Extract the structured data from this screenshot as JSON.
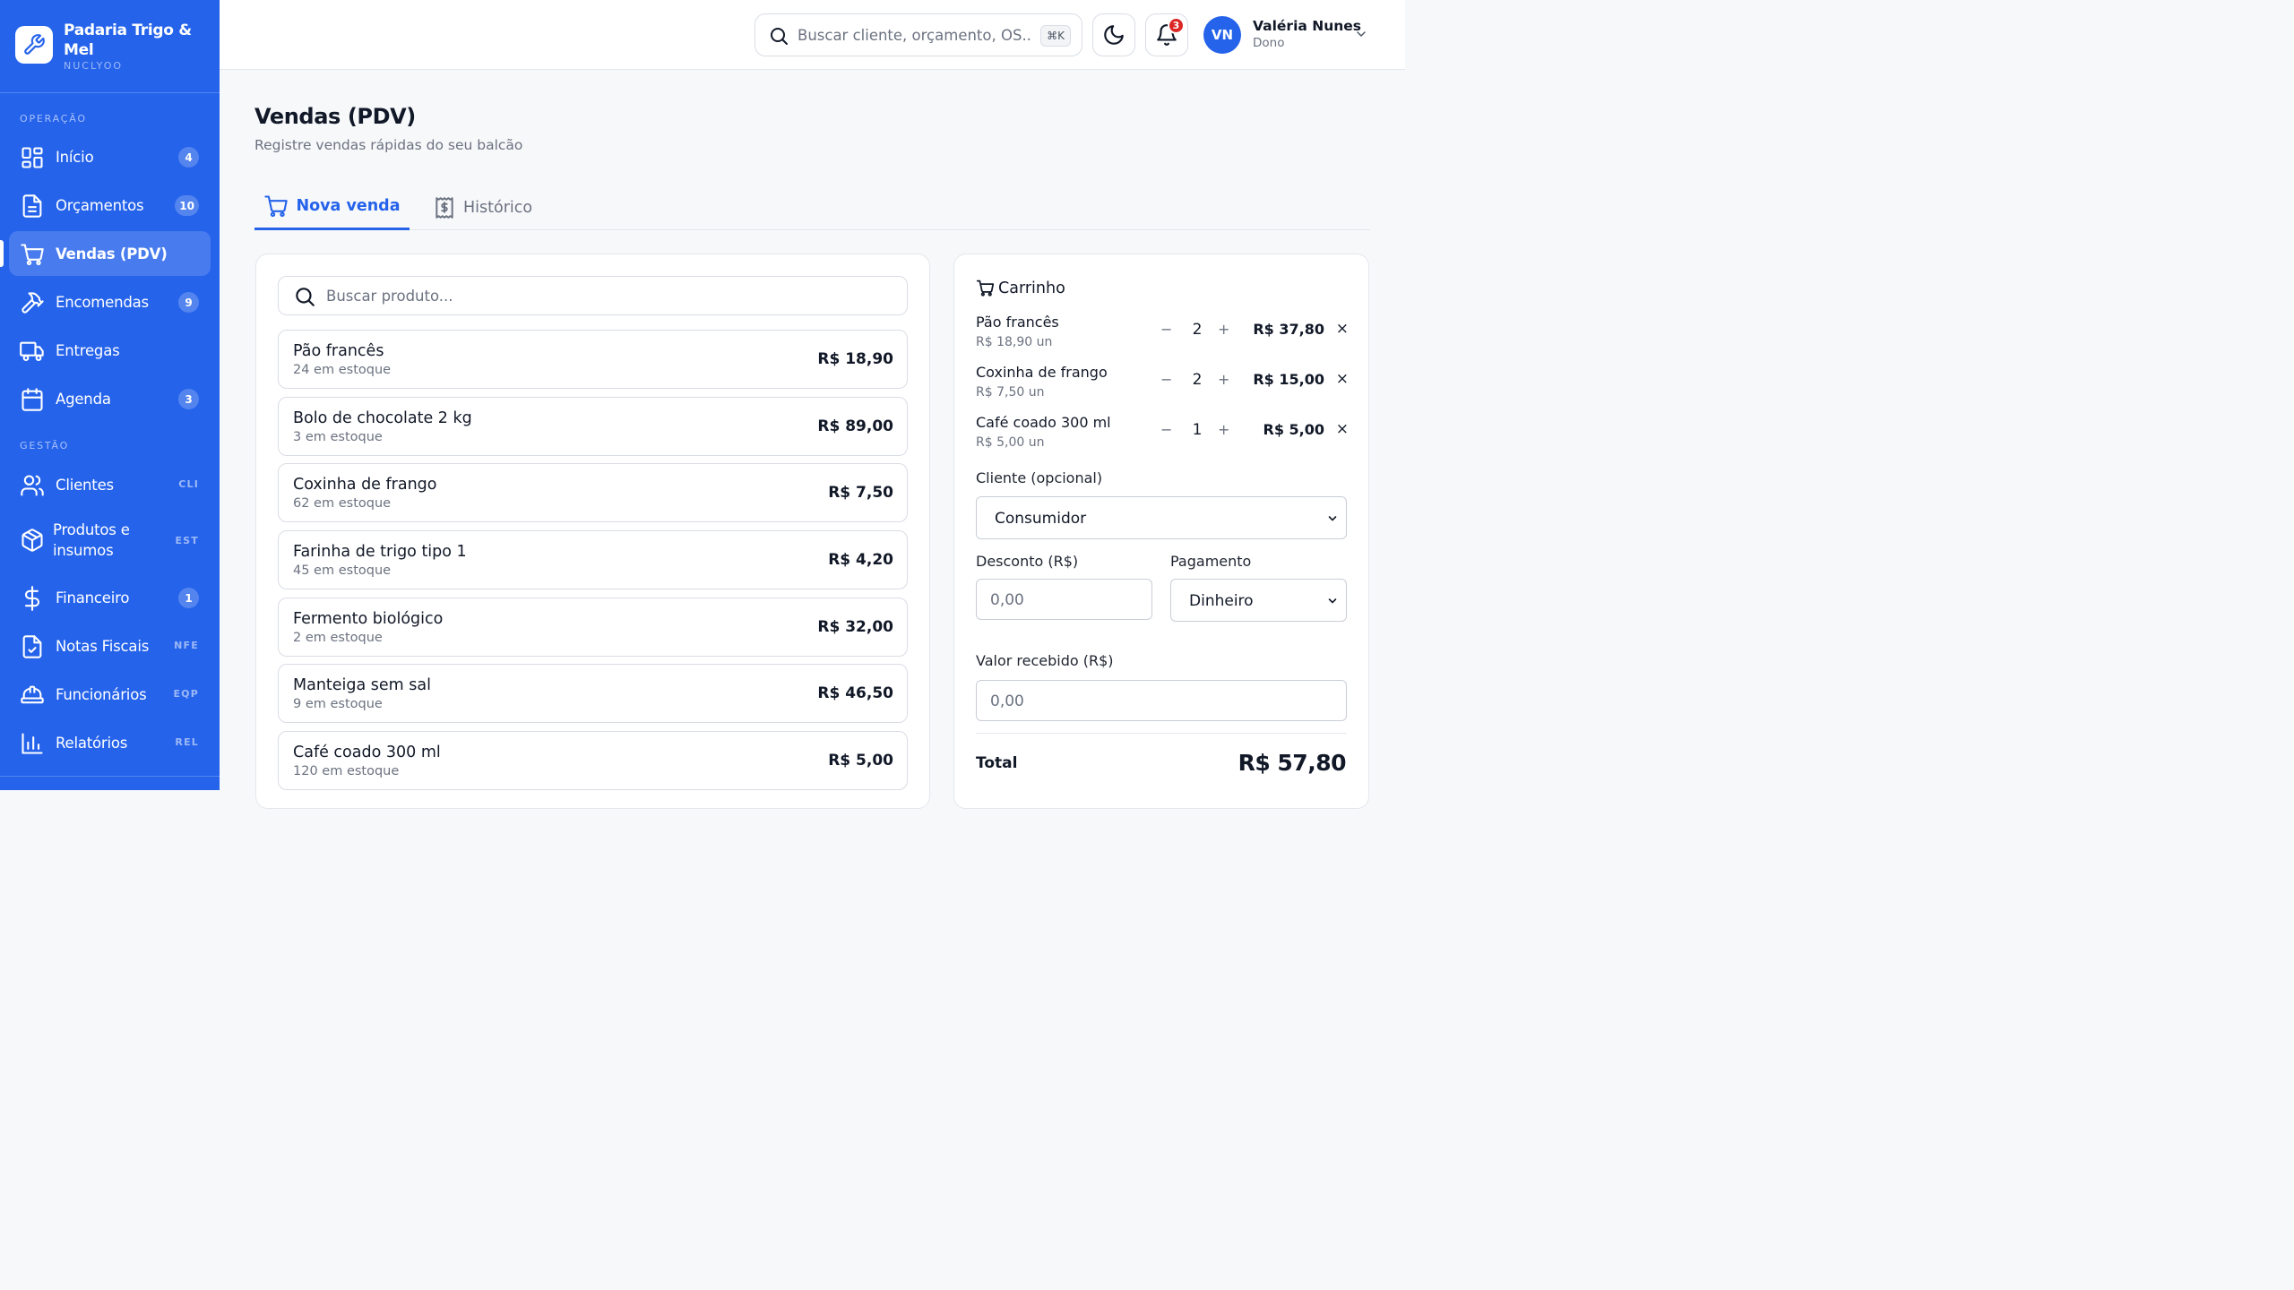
{
  "brand": {
    "name": "Padaria Trigo & Mel",
    "sub": "NUCLYOO"
  },
  "sidebar": {
    "section_operacao": "OPERAÇÃO",
    "section_gestao": "GESTÃO",
    "items": [
      {
        "label": "Início",
        "badge": "4",
        "icon": "dashboard-icon"
      },
      {
        "label": "Orçamentos",
        "badge": "10",
        "icon": "document-icon"
      },
      {
        "label": "Vendas (PDV)",
        "icon": "cart-icon",
        "active": true
      },
      {
        "label": "Encomendas",
        "badge": "9",
        "icon": "hammer-icon"
      },
      {
        "label": "Entregas",
        "icon": "truck-icon"
      },
      {
        "label": "Agenda",
        "badge": "3",
        "icon": "calendar-icon"
      },
      {
        "label": "Clientes",
        "code": "CLI",
        "icon": "users-icon"
      },
      {
        "label": "Produtos e insumos",
        "code": "EST",
        "icon": "package-icon"
      },
      {
        "label": "Financeiro",
        "badge": "1",
        "icon": "dollar-icon"
      },
      {
        "label": "Notas Fiscais",
        "code": "NFE",
        "icon": "file-check-icon"
      },
      {
        "label": "Funcionários",
        "code": "EQP",
        "icon": "hard-hat-icon"
      },
      {
        "label": "Relatórios",
        "code": "REL",
        "icon": "bar-chart-icon"
      }
    ]
  },
  "topbar": {
    "search_placeholder": "Buscar cliente, orçamento, OS...",
    "search_shortcut": "⌘K",
    "notification_count": "3",
    "user": {
      "initials": "VN",
      "name": "Valéria Nunes",
      "role": "Dono"
    }
  },
  "page": {
    "title": "Vendas (PDV)",
    "subtitle": "Registre vendas rápidas do seu balcão",
    "tabs": [
      {
        "label": "Nova venda",
        "active": true
      },
      {
        "label": "Histórico"
      }
    ]
  },
  "products": {
    "search_placeholder": "Buscar produto...",
    "items": [
      {
        "name": "Pão francês",
        "stock": "24 em estoque",
        "price": "R$ 18,90"
      },
      {
        "name": "Bolo de chocolate 2 kg",
        "stock": "3 em estoque",
        "price": "R$ 89,00"
      },
      {
        "name": "Coxinha de frango",
        "stock": "62 em estoque",
        "price": "R$ 7,50"
      },
      {
        "name": "Farinha de trigo tipo 1",
        "stock": "45 em estoque",
        "price": "R$ 4,20"
      },
      {
        "name": "Fermento biológico",
        "stock": "2 em estoque",
        "price": "R$ 32,00"
      },
      {
        "name": "Manteiga sem sal",
        "stock": "9 em estoque",
        "price": "R$ 46,50"
      },
      {
        "name": "Café coado 300 ml",
        "stock": "120 em estoque",
        "price": "R$ 5,00"
      }
    ]
  },
  "cart": {
    "title": "Carrinho",
    "items": [
      {
        "name": "Pão francês",
        "unit": "R$ 18,90 un",
        "qty": "2",
        "total": "R$ 37,80"
      },
      {
        "name": "Coxinha de frango",
        "unit": "R$ 7,50 un",
        "qty": "2",
        "total": "R$ 15,00"
      },
      {
        "name": "Café coado 300 ml",
        "unit": "R$ 5,00 un",
        "qty": "1",
        "total": "R$ 5,00"
      }
    ],
    "minus": "−",
    "plus": "+",
    "remove": "×",
    "client_label": "Cliente (opcional)",
    "client_value": "Consumidor",
    "discount_label": "Desconto (R$)",
    "discount_placeholder": "0,00",
    "payment_label": "Pagamento",
    "payment_value": "Dinheiro",
    "received_label": "Valor recebido (R$)",
    "received_placeholder": "0,00",
    "total_label": "Total",
    "total_value": "R$ 57,80"
  },
  "colors": {
    "accent": "#2563eb",
    "badge_red": "#dc2626"
  }
}
